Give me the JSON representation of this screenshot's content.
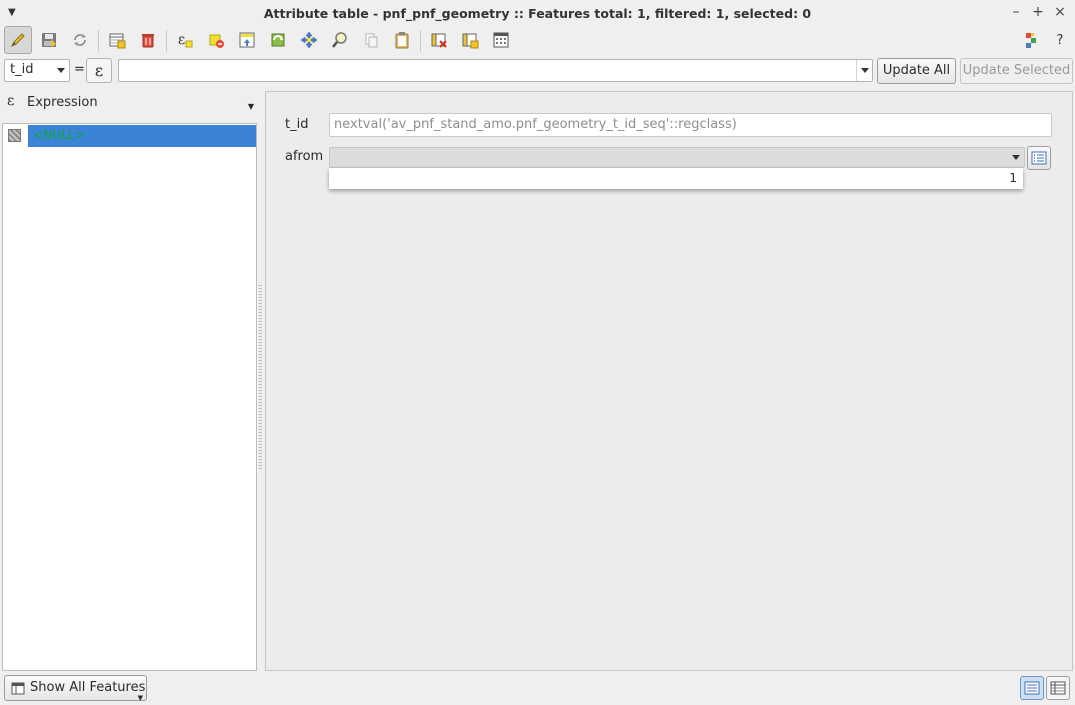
{
  "window": {
    "title": "Attribute table - pnf_pnf_geometry :: Features total: 1, filtered: 1, selected: 0",
    "minimize_symbol": "–",
    "maximize_symbol": "+",
    "close_symbol": "×"
  },
  "toolbar": {
    "icons": [
      "toggle-editing-icon",
      "save-edits-icon",
      "reload-table-icon",
      "add-feature-icon",
      "delete-selected-icon",
      "select-by-expression-icon",
      "deselect-all-icon",
      "move-selection-to-top-icon",
      "invert-selection-icon",
      "pan-to-selected-icon",
      "zoom-to-selected-icon",
      "copy-selected-icon",
      "paste-features-icon",
      "delete-field-icon",
      "new-field-icon",
      "open-field-calculator-icon",
      "dock-table-icon",
      "help-icon"
    ],
    "help_label": "?"
  },
  "calc_bar": {
    "field_value": "t_id",
    "equals_label": "=",
    "expression_button_symbol": "ε",
    "expression_value": "",
    "update_all_label": "Update All",
    "update_selected_label": "Update Selected"
  },
  "left_panel": {
    "header_label": "Expression",
    "items": [
      {
        "label": "<NULL>",
        "selected": true
      }
    ]
  },
  "form": {
    "fields": [
      {
        "label": "t_id",
        "value": "nextval('av_pnf_stand_amo.pnf_geometry_t_id_seq'::regclass)"
      },
      {
        "label": "afrom",
        "value": ""
      }
    ],
    "dropdown_options": [
      "1"
    ]
  },
  "footer": {
    "show_all_label": "Show All Features"
  },
  "colors": {
    "selection": "#3b83d4",
    "null_text": "#0aa83a",
    "background": "#efefef"
  }
}
